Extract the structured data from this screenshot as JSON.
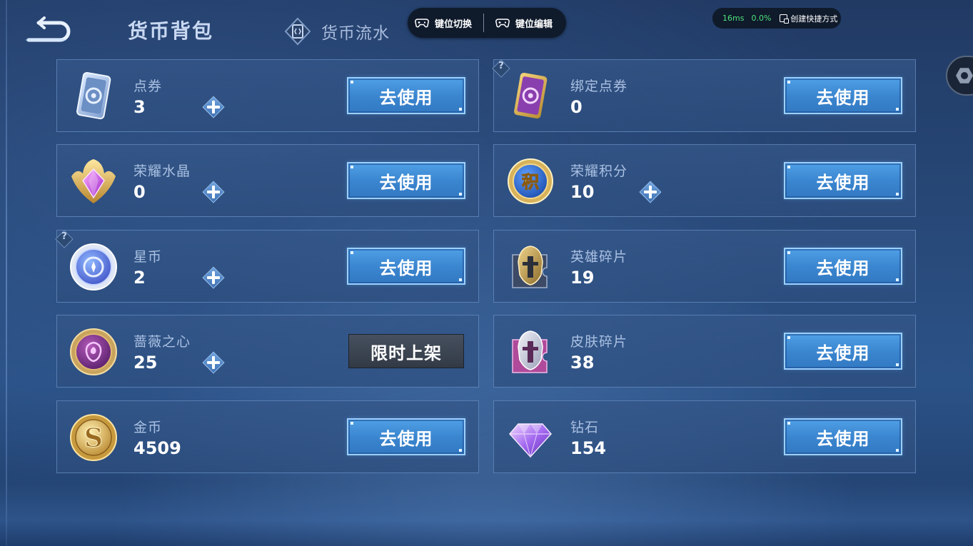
{
  "header": {
    "title": "货币背包",
    "flow_tab_label": "货币流水"
  },
  "key_bar": {
    "switch_label": "键位切换",
    "edit_label": "键位编辑"
  },
  "status": {
    "latency": "16ms",
    "loss": "0.0%",
    "shortcut_label": "创建快捷方式"
  },
  "currencies": [
    {
      "name": "点券",
      "amount": "3",
      "has_plus": true,
      "action": "去使用",
      "icon": "ticket-icon"
    },
    {
      "name": "绑定点券",
      "amount": "0",
      "has_plus": false,
      "action": "去使用",
      "icon": "bound-ticket-icon",
      "help": "?"
    },
    {
      "name": "荣耀水晶",
      "amount": "0",
      "has_plus": true,
      "action": "去使用",
      "icon": "glory-crystal-icon"
    },
    {
      "name": "荣耀积分",
      "amount": "10",
      "has_plus": true,
      "action": "去使用",
      "icon": "glory-points-icon",
      "icon_glyph": "积"
    },
    {
      "name": "星币",
      "amount": "2",
      "has_plus": true,
      "action": "去使用",
      "icon": "star-coin-icon",
      "help": "?"
    },
    {
      "name": "英雄碎片",
      "amount": "19",
      "has_plus": false,
      "action": "去使用",
      "icon": "hero-fragment-icon"
    },
    {
      "name": "蔷薇之心",
      "amount": "25",
      "has_plus": true,
      "action": "限时上架",
      "icon": "rose-heart-icon"
    },
    {
      "name": "皮肤碎片",
      "amount": "38",
      "has_plus": false,
      "action": "去使用",
      "icon": "skin-fragment-icon"
    },
    {
      "name": "金币",
      "amount": "4509",
      "has_plus": false,
      "action": "去使用",
      "icon": "gold-coin-icon",
      "icon_glyph": "S"
    },
    {
      "name": "钻石",
      "amount": "154",
      "has_plus": false,
      "action": "去使用",
      "icon": "diamond-icon"
    }
  ],
  "colors": {
    "use_button": "#3b86d0",
    "limited_button": "#3a4350",
    "latency_green": "#4fe07a"
  }
}
